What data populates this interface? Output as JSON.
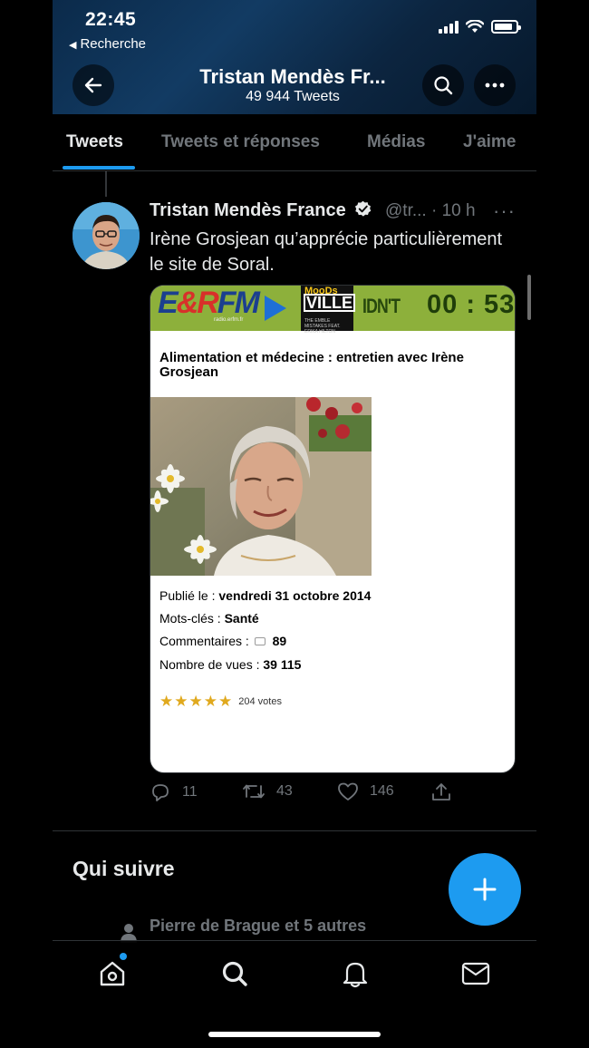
{
  "status_bar": {
    "time": "22:45",
    "back_app": "Recherche",
    "back_arrow": "◀"
  },
  "header": {
    "title": "Tristan Mendès Fr...",
    "subtitle": "49 944 Tweets",
    "back_icon": "arrow-left-icon",
    "search_icon": "search-icon",
    "more_icon": "more-horizontal-icon"
  },
  "tabs": [
    {
      "label": "Tweets",
      "active": true
    },
    {
      "label": "Tweets et réponses",
      "active": false
    },
    {
      "label": "Médias",
      "active": false
    },
    {
      "label": "J'aime",
      "active": false
    }
  ],
  "tweet": {
    "author_name": "Tristan Mendès France",
    "handle_time": "@tr... · 10 h",
    "more": "···",
    "text": "Irène Grosjean qu’apprécie particulièrement le site de Soral.",
    "media": {
      "banner": {
        "logo": "E&RFM",
        "logo_sub": "radio.erfm.fr",
        "album_top": "MooDs",
        "album_main": "VILLE",
        "album_small": "THE EMBLE MISTAKES FEAT. ERIKA HILTON",
        "song": "IDN'T K",
        "timer": "00 : 53"
      },
      "article_title": "Alimentation et médecine : entretien avec Irène Grosjean",
      "published_label": "Publié le :",
      "published_value": "vendredi 31 octobre 2014",
      "keywords_label": "Mots-clés :",
      "keywords_value": "Santé",
      "comments_label": "Commentaires :",
      "comments_value": "89",
      "views_label": "Nombre de vues :",
      "views_value": "39 115",
      "rating_stars": 5,
      "votes": "204 votes"
    },
    "actions": {
      "replies": "11",
      "retweets": "43",
      "likes": "146"
    }
  },
  "who_to_follow": {
    "title": "Qui suivre",
    "suggestion": "Pierre de Brague et 5 autres"
  },
  "bottom_nav": {
    "items": [
      "home-icon",
      "search-icon",
      "bell-icon",
      "mail-icon"
    ]
  },
  "colors": {
    "accent": "#1d9bf0",
    "background": "#000000",
    "muted": "#71767b",
    "banner_green": "#8db03b"
  }
}
